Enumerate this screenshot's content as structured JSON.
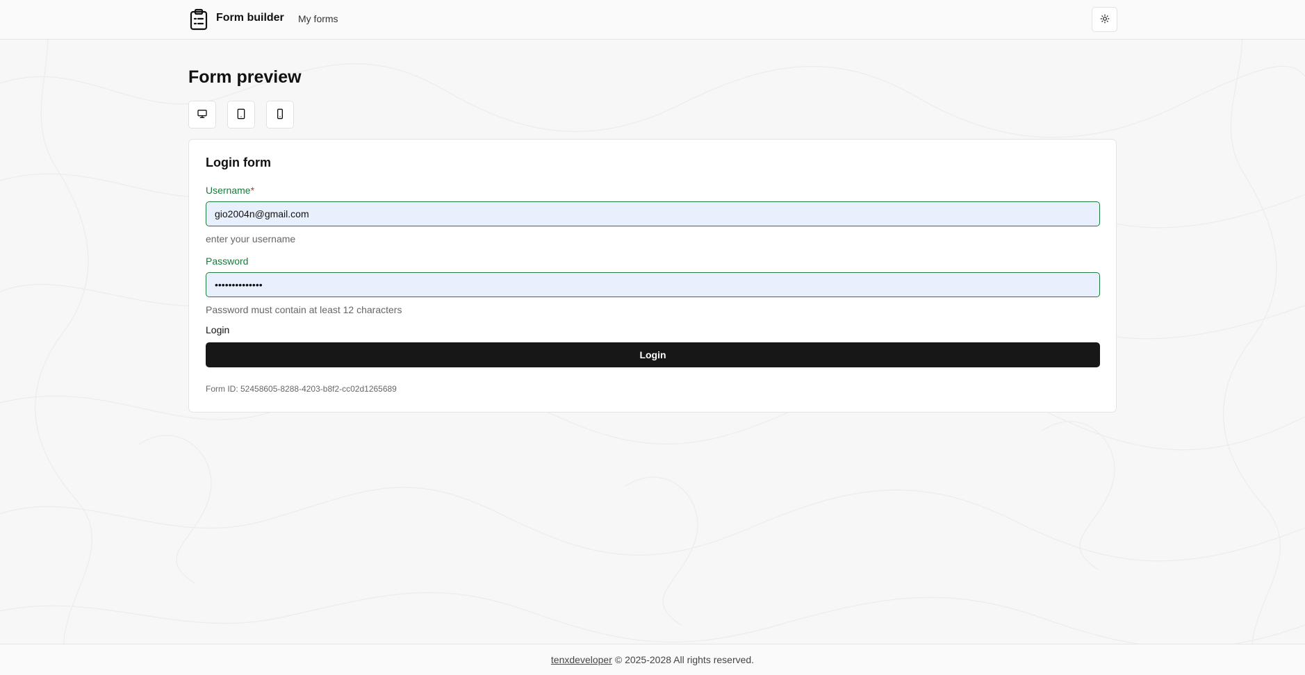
{
  "header": {
    "brand_title": "Form builder",
    "nav_my_forms": "My forms",
    "brand_icon": "clipboard-list-icon",
    "theme_icon": "sun-icon"
  },
  "main": {
    "page_title": "Form preview",
    "device_buttons": [
      {
        "icon": "monitor-icon"
      },
      {
        "icon": "tablet-icon"
      },
      {
        "icon": "smartphone-icon"
      }
    ]
  },
  "form": {
    "title": "Login form",
    "username": {
      "label": "Username",
      "required_mark": "*",
      "value": "gio2004n@gmail.com",
      "hint": "enter your username"
    },
    "password": {
      "label": "Password",
      "value": "••••••••••••••",
      "hint": "Password must contain at least 12 characters"
    },
    "submit_field_label": "Login",
    "submit_button": "Login",
    "form_id": "Form ID: 52458605-8288-4203-b8f2-cc02d1265689"
  },
  "footer": {
    "link_text": "tenxdeveloper",
    "copyright": "© 2025-2028 All rights reserved."
  },
  "colors": {
    "accent_green": "#1b7a3b",
    "required_red": "#d12b2b",
    "button_dark": "#171717",
    "input_fill": "#e8f0fe"
  }
}
